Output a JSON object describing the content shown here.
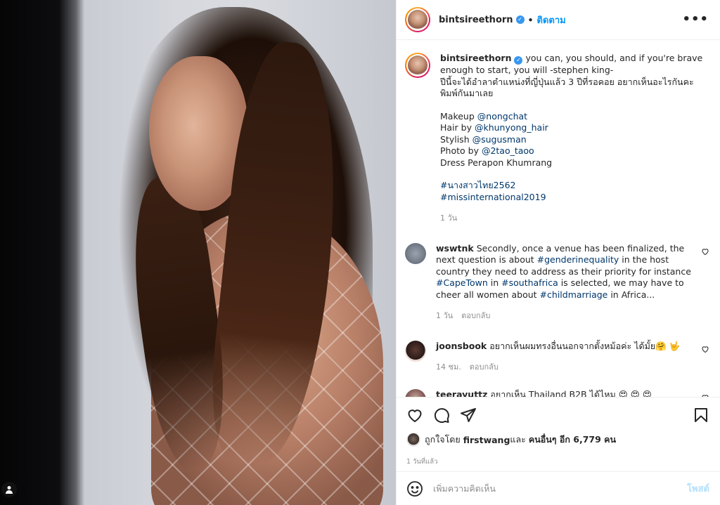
{
  "post": {
    "username": "bintsireethorn",
    "follow_separator": "•",
    "follow_label": "ติดตาม",
    "more_label": "•••"
  },
  "caption": {
    "username": "bintsireethorn",
    "line1": "you can, you should, and if you're brave enough to start, you will -stephen king-",
    "line2": "ปีนี้จะได้อำลาตำแหน่งที่ญี่ปุ่นแล้ว 3 ปีที่รอคอย อยากเห็นอะไรกันคะ พิมพ์กันมาเลย",
    "credits": [
      {
        "label": "Makeup ",
        "handle": "@nongchat"
      },
      {
        "label": "Hair by ",
        "handle": "@khunyong_hair"
      },
      {
        "label": "Stylish ",
        "handle": "@sugusman"
      },
      {
        "label": "Photo by ",
        "handle": "@2tao_taoo"
      },
      {
        "label": "Dress Perapon Khumrang",
        "handle": ""
      }
    ],
    "hashtags": [
      "#นางสาวไทย2562",
      "#missinternational2019"
    ],
    "time": "1 วัน"
  },
  "comments": [
    {
      "username": "wswtnk",
      "parts": [
        {
          "t": "Secondly, once a venue has been finalized, the next question is about "
        },
        {
          "link": "#genderinequality"
        },
        {
          "t": " in the host country they need to address as their priority for instance "
        },
        {
          "link": "#CapeTown"
        },
        {
          "t": " in "
        },
        {
          "link": "#southafrica"
        },
        {
          "t": " is selected, we may have to cheer all women about "
        },
        {
          "link": "#childmarriage"
        },
        {
          "t": " in Africa..."
        }
      ],
      "time": "1 วัน",
      "reply": "ตอบกลับ"
    },
    {
      "username": "joonsbook",
      "text": "อยากเห็นผมทรงอื่นนอกจากตั้งหม้อค่ะ ได้มั้ย🤗 🤟",
      "time": "14 ชม.",
      "reply": "ตอบกลับ"
    },
    {
      "username": "teerayuttz",
      "text": "อยากเห็น Thailand B2B ได้ไหม 😍 😍 😍"
    }
  ],
  "actions": {
    "like_icon": "heart-icon",
    "comment_icon": "comment-icon",
    "share_icon": "share-icon",
    "save_icon": "bookmark-icon"
  },
  "likes": {
    "prefix": "ถูกใจโดย ",
    "user": "firstwang",
    "middle": " และ ",
    "others": "คนอื่นๆ อีก 6,779 คน"
  },
  "posted_time": "1 วันที่แล้ว",
  "add_comment": {
    "placeholder": "เพิ่มความคิดเห็น",
    "post_label": "โพสต์"
  },
  "colors": {
    "link": "#00376b",
    "accent": "#0095f6",
    "post_disabled": "#b2dffc"
  }
}
